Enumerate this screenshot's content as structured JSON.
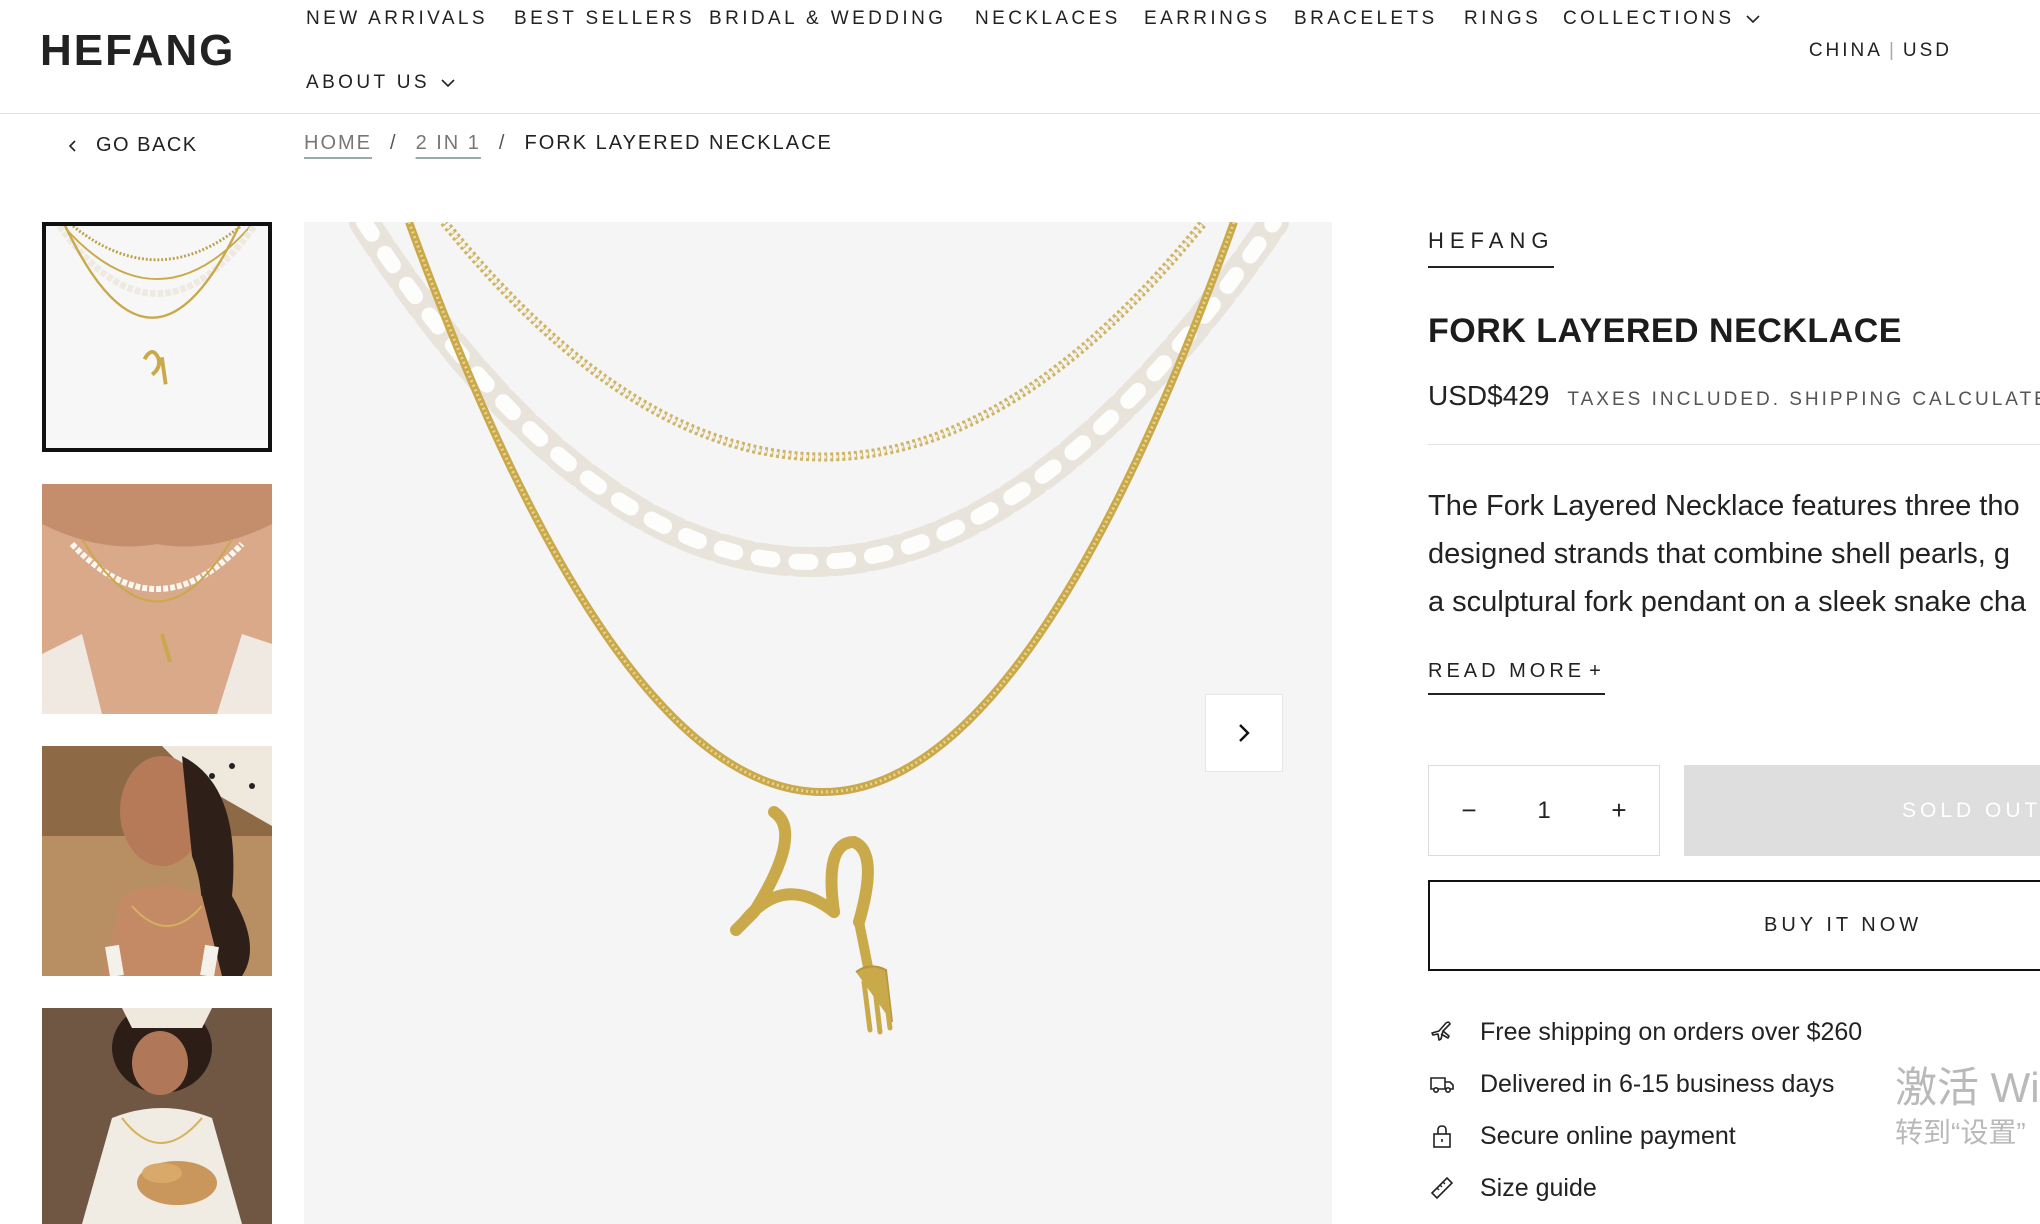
{
  "header": {
    "logo": "HEFANG",
    "nav": [
      {
        "label": "NEW ARRIVALS"
      },
      {
        "label": "BEST SELLERS"
      },
      {
        "label": "BRIDAL & WEDDING"
      },
      {
        "label": "NECKLACES"
      },
      {
        "label": "EARRINGS"
      },
      {
        "label": "BRACELETS"
      },
      {
        "label": "RINGS"
      },
      {
        "label": "COLLECTIONS",
        "icon": "chevron-down-icon"
      },
      {
        "label": "ABOUT US",
        "icon": "chevron-down-icon"
      }
    ],
    "locale": {
      "country": "CHINA",
      "separator": "|",
      "currency": "USD"
    }
  },
  "go_back": {
    "label": "GO BACK",
    "icon": "chevron-left-icon"
  },
  "breadcrumb": [
    {
      "label": "HOME",
      "link": true
    },
    {
      "label": "2 IN 1",
      "link": true
    },
    {
      "label": "FORK LAYERED NECKLACE",
      "link": false
    }
  ],
  "gallery": {
    "thumbnails": [
      {
        "name": "necklace-product-shot",
        "active": true
      },
      {
        "name": "necklace-worn-closeup",
        "active": false
      },
      {
        "name": "model-smiling-headscarf",
        "active": false
      },
      {
        "name": "model-holding-bread",
        "active": false
      }
    ],
    "next_icon": "chevron-right-icon"
  },
  "product": {
    "brand": "HEFANG",
    "title": "FORK LAYERED NECKLACE",
    "price": "USD$429",
    "tax_note": "TAXES INCLUDED. SHIPPING CALCULATED",
    "description_lines": [
      "The Fork Layered Necklace features three tho",
      "designed strands that combine shell pearls, g",
      "a sculptural fork pendant on a sleek snake cha"
    ],
    "read_more": "READ MORE",
    "read_more_icon": "+",
    "quantity": {
      "value": "1",
      "minus": "−",
      "plus": "+"
    },
    "sold_out": "SOLD OUT",
    "buy_now": "BUY IT NOW",
    "features": [
      {
        "icon": "airplane-icon",
        "text": "Free shipping on orders over $260"
      },
      {
        "icon": "truck-icon",
        "text": "Delivered in 6-15 business days"
      },
      {
        "icon": "lock-icon",
        "text": "Secure online payment"
      },
      {
        "icon": "ruler-icon",
        "text": "Size guide"
      }
    ]
  },
  "watermark": {
    "line1": "激活 Wi",
    "line2": "转到“设置”"
  },
  "colors": {
    "gold": "#c9a94a",
    "pearl": "#f6f4ef",
    "image_bg": "#f5f5f5",
    "soldout_bg": "#dedede"
  }
}
